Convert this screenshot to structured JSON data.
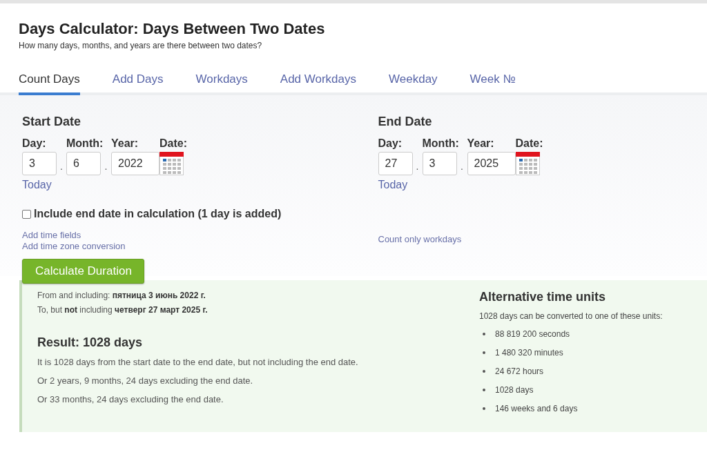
{
  "page": {
    "title": "Days Calculator: Days Between Two Dates",
    "subtitle": "How many days, months, and years are there between two dates?"
  },
  "tabs": [
    {
      "label": "Count Days",
      "selected": true
    },
    {
      "label": "Add Days",
      "selected": false
    },
    {
      "label": "Workdays",
      "selected": false
    },
    {
      "label": "Add Workdays",
      "selected": false
    },
    {
      "label": "Weekday",
      "selected": false
    },
    {
      "label": "Week №",
      "selected": false
    }
  ],
  "date_groups": [
    {
      "heading": "Start Date",
      "fields": [
        {
          "label": "Day:",
          "value": "3"
        },
        {
          "label": "Month:",
          "value": "6"
        },
        {
          "label": "Year:",
          "value": "2022"
        }
      ],
      "separators": [
        ".",
        "."
      ],
      "date_label": "Date:",
      "today_link": "Today",
      "links": [
        "Add time fields",
        "Add time zone conversion"
      ]
    },
    {
      "heading": "End Date",
      "fields": [
        {
          "label": "Day:",
          "value": "27"
        },
        {
          "label": "Month:",
          "value": "3"
        },
        {
          "label": "Year:",
          "value": "2025"
        }
      ],
      "separators": [
        ".",
        "."
      ],
      "date_label": "Date:",
      "today_link": "Today",
      "links": [
        "Count only workdays"
      ]
    }
  ],
  "include_end_date": {
    "label": "Include end date in calculation (1 day is added)",
    "checked": false
  },
  "calculate_button": "Calculate Duration",
  "result": {
    "from_line": "From and including: **пятница 3 июнь 2022 г.**",
    "to_line": "To, but **not** including **четверг 27 март 2025 г.**",
    "heading": "Result: 1028 days",
    "lines": [
      "It is 1028 days from the start date to the end date, but not including the end date.",
      "Or 2 years, 9 months, 24 days excluding the end date.",
      "Or 33 months, 24 days excluding the end date."
    ]
  },
  "alternative_units": {
    "heading": "Alternative time units",
    "intro": "1028 days can be converted to one of these units:",
    "items": [
      "88 819 200 seconds",
      "1 480 320 minutes",
      "24 672 hours",
      "1028 days",
      "146 weeks and 6 days"
    ]
  }
}
